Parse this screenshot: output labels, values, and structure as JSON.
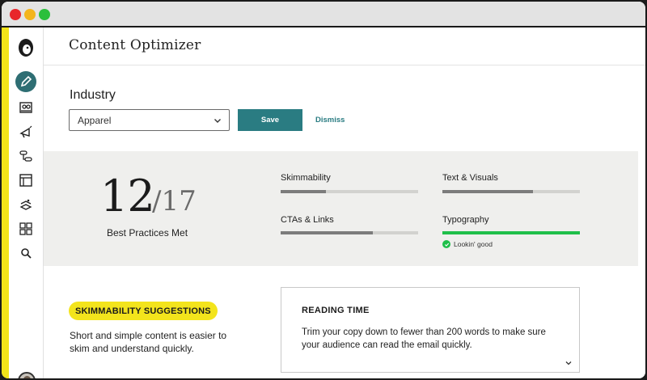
{
  "app": {
    "title": "Content Optimizer"
  },
  "industry": {
    "label": "Industry",
    "selected": "Apparel",
    "save_label": "Save",
    "dismiss_label": "Dismiss"
  },
  "score": {
    "met": "12",
    "total": "/17",
    "caption": "Best Practices Met"
  },
  "metrics": [
    {
      "label": "Skimmability",
      "progress": 0.33
    },
    {
      "label": "Text & Visuals",
      "progress": 0.66
    },
    {
      "label": "CTAs & Links",
      "progress": 0.67
    },
    {
      "label": "Typography",
      "progress": 1.0,
      "status": "Lookin' good"
    }
  ],
  "suggestion": {
    "tag": "SKIMMABILITY SUGGESTIONS",
    "description": "Short and simple content is easier to skim and understand quickly."
  },
  "reading_time": {
    "title": "READING TIME",
    "body": "Trim your copy down to fewer than 200 words to make sure your audience can read the email quickly."
  },
  "colors": {
    "accent": "#2a7c82",
    "highlight": "#f3e41c",
    "success": "#1fbf4a"
  },
  "sidebar_icons": [
    "mailchimp-logo-icon",
    "pencil-icon",
    "audience-icon",
    "campaign-megaphone-icon",
    "automation-flow-icon",
    "website-icon",
    "integrations-icon",
    "apps-grid-icon",
    "search-icon"
  ]
}
